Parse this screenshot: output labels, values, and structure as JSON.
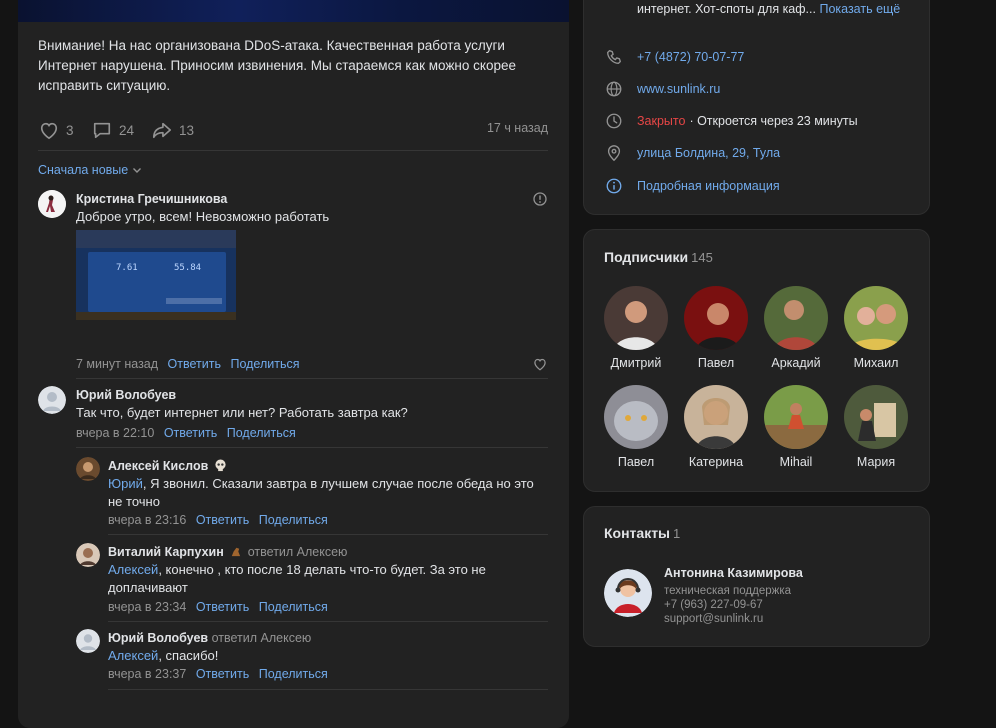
{
  "post": {
    "text": "Внимание! На нас организована DDoS-атака. Качественная работа услуги Интернет нарушена. Приносим извинения. Мы стараемся как можно скорее исправить ситуацию.",
    "likes": "3",
    "comments": "24",
    "shares": "13",
    "time": "17 ч назад",
    "sort_label": "Сначала новые"
  },
  "comments": [
    {
      "author": "Кристина Гречишникова",
      "text": "Доброе утро, всем! Невозможно работать",
      "time": "7 минут назад",
      "reply": "Ответить",
      "share": "Поделиться",
      "screenshot": {
        "download_value": "7.61",
        "upload_value": "55.84"
      }
    },
    {
      "author": "Юрий Волобуев",
      "text": "Так что, будет интернет или нет? Работать завтра как?",
      "time": "вчера в 22:10",
      "reply": "Ответить",
      "share": "Поделиться"
    },
    {
      "author": "Алексей Кислов",
      "mention": "Юрий",
      "text": ", Я звонил. Сказали завтра в лучшем случае после обеда но это не точно",
      "time": "вчера в 23:16",
      "reply": "Ответить",
      "share": "Поделиться"
    },
    {
      "author": "Виталий Карпухин",
      "replied_to": "ответил Алексею",
      "mention": "Алексей",
      "text": ", конечно , кто после 18 делать что-то будет. За это не доплачивают",
      "time": "вчера в 23:34",
      "reply": "Ответить",
      "share": "Поделиться"
    },
    {
      "author": "Юрий Волобуев",
      "replied_to": "ответил Алексею",
      "mention": "Алексей",
      "text": ", спасибо!",
      "time": "вчера в 23:37",
      "reply": "Ответить",
      "share": "Поделиться"
    }
  ],
  "info": {
    "description_tail": "интернет. Хот-споты для каф...",
    "show_more": "Показать ещё",
    "phone": "+7 (4872) 70-07-77",
    "website": "www.sunlink.ru",
    "status_closed": "Закрыто",
    "status_open": "· Откроется через 23 минуты",
    "address": "улица Болдина, 29, Тула",
    "more_info": "Подробная информация"
  },
  "subscribers": {
    "title": "Подписчики",
    "count": "145",
    "people": [
      "Дмитрий",
      "Павел",
      "Аркадий",
      "Михаил",
      "Павел",
      "Катерина",
      "Mihail",
      "Мария"
    ]
  },
  "contacts": {
    "title": "Контакты",
    "count": "1",
    "name": "Антонина Казимирова",
    "role": "техническая поддержка",
    "phone": "+7 (963) 227-09-67",
    "email": "support@sunlink.ru"
  },
  "colors": {
    "accent": "#71aaeb",
    "closed": "#e64646",
    "card": "#222222",
    "background": "#141414"
  }
}
